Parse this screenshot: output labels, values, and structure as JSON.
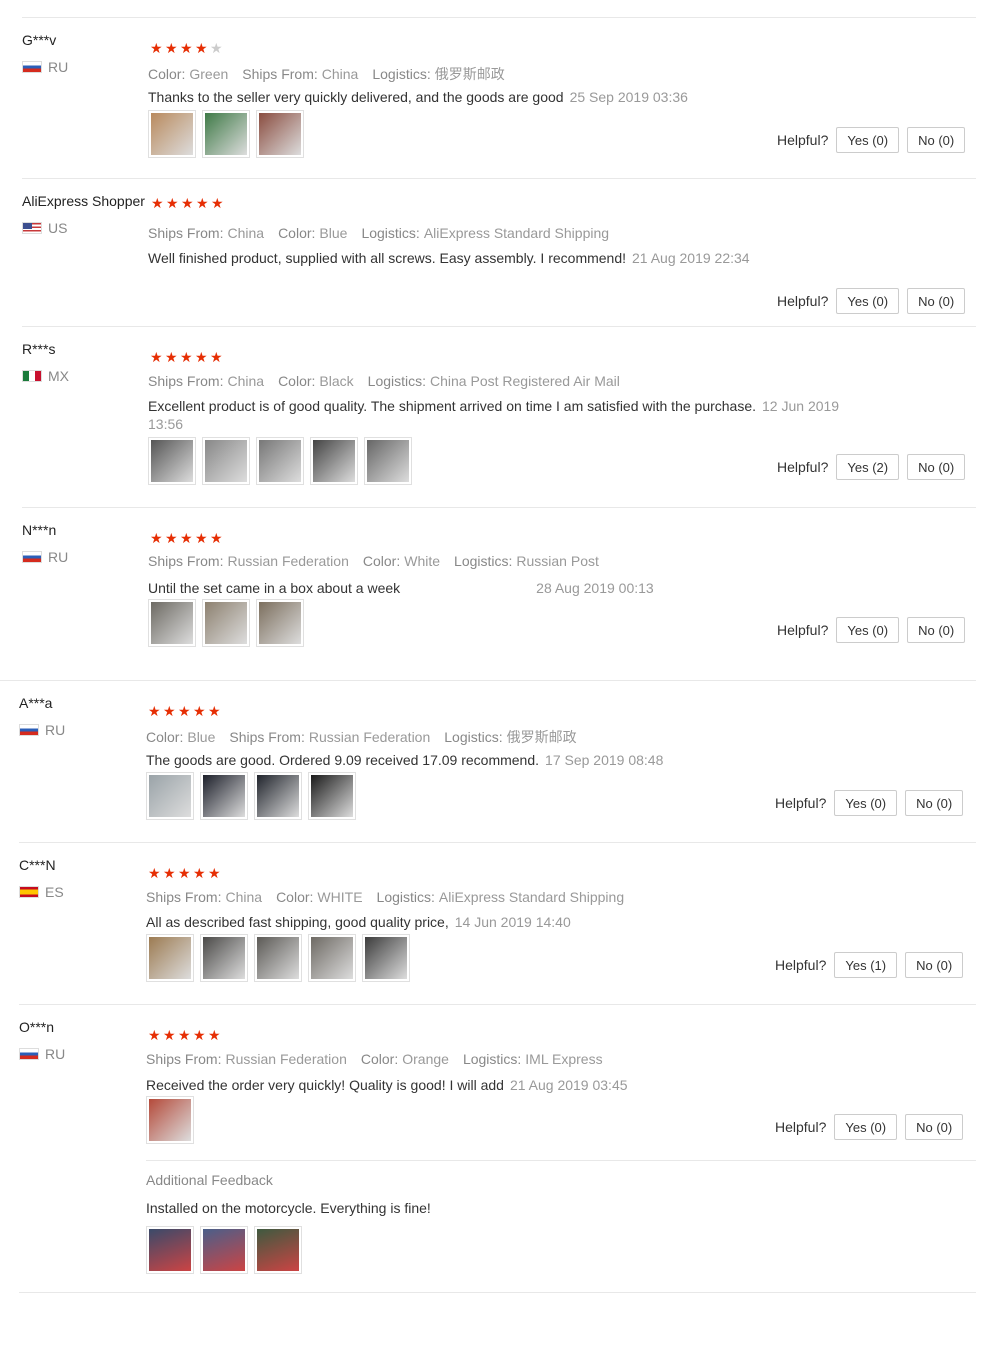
{
  "labels": {
    "helpful": "Helpful?",
    "ships_from": "Ships From:",
    "color": "Color:",
    "logistics": "Logistics:",
    "additional_feedback": "Additional Feedback"
  },
  "reviews": [
    {
      "user": "G***v",
      "country": "RU",
      "flag": "ru",
      "rating": 4,
      "meta": [
        [
          "color",
          "Green"
        ],
        [
          "ships_from",
          "China"
        ],
        [
          "logistics",
          "俄罗斯邮政"
        ]
      ],
      "text": "Thanks to the seller very quickly delivered, and the goods are good",
      "date": "25 Sep 2019 03:36",
      "photos": [
        "#b98a5e",
        "#3f7a47",
        "#8a4d40"
      ],
      "yes": "Yes (0)",
      "no": "No (0)"
    },
    {
      "user": "AliExpress Shopper",
      "country": "US",
      "flag": "us",
      "rating": 5,
      "meta": [
        [
          "ships_from",
          "China"
        ],
        [
          "color",
          "Blue"
        ],
        [
          "logistics",
          "AliExpress Standard Shipping"
        ]
      ],
      "text": "Well finished product, supplied with all screws. Easy assembly. I recommend!",
      "date": "21 Aug 2019 22:34",
      "photos": [],
      "yes": "Yes (0)",
      "no": "No (0)"
    },
    {
      "user": "R***s",
      "country": "MX",
      "flag": "mx",
      "rating": 5,
      "meta": [
        [
          "ships_from",
          "China"
        ],
        [
          "color",
          "Black"
        ],
        [
          "logistics",
          "China Post Registered Air Mail"
        ]
      ],
      "text": "Excellent product is of good quality. The shipment arrived on time I am satisfied with the purchase.",
      "date": "12 Jun 2019 13:56",
      "photos": [
        "#555",
        "#888",
        "#777",
        "#444",
        "#666"
      ],
      "yes": "Yes (2)",
      "no": "No (0)"
    },
    {
      "user": "N***n",
      "country": "RU",
      "flag": "ru",
      "rating": 5,
      "meta": [
        [
          "ships_from",
          "Russian Federation"
        ],
        [
          "color",
          "White"
        ],
        [
          "logistics",
          "Russian Post"
        ]
      ],
      "text": "Until the set came in a box about a week",
      "date": "28 Aug 2019 00:13",
      "photos": [
        "#6d6a63",
        "#8d8170",
        "#7c6f5e"
      ],
      "yes": "Yes (0)",
      "no": "No (0)"
    },
    {
      "user": "A***a",
      "country": "RU",
      "flag": "ru",
      "rating": 5,
      "meta": [
        [
          "color",
          "Blue"
        ],
        [
          "ships_from",
          "Russian Federation"
        ],
        [
          "logistics",
          "俄罗斯邮政"
        ]
      ],
      "text": "The goods are good. Ordered 9.09 received 17.09 recommend.",
      "date": "17 Sep 2019 08:48",
      "photos": [
        "#9aa3a8",
        "#1c1f2a",
        "#20242c",
        "#1a1a1a"
      ],
      "yes": "Yes (0)",
      "no": "No (0)"
    },
    {
      "user": "C***N",
      "country": "ES",
      "flag": "es",
      "rating": 5,
      "meta": [
        [
          "ships_from",
          "China"
        ],
        [
          "color",
          "WHITE"
        ],
        [
          "logistics",
          "AliExpress Standard Shipping"
        ]
      ],
      "text": "All as described fast shipping, good quality price,",
      "date": "14 Jun 2019 14:40",
      "photos": [
        "#9c7b52",
        "#4b4a48",
        "#5c5a56",
        "#6e6a64",
        "#3c3c3c"
      ],
      "yes": "Yes (1)",
      "no": "No (0)"
    },
    {
      "user": "O***n",
      "country": "RU",
      "flag": "ru",
      "rating": 5,
      "meta": [
        [
          "ships_from",
          "Russian Federation"
        ],
        [
          "color",
          "Orange"
        ],
        [
          "logistics",
          "IML Express"
        ]
      ],
      "text": "Received the order very quickly! Quality is good! I will add",
      "date": "21 Aug 2019 03:45",
      "photos": [
        "#b44a3a"
      ],
      "yes": "Yes (0)",
      "no": "No (0)",
      "additional": {
        "text": "Installed on the motorcycle. Everything is fine!",
        "photos": [
          "#3a4a6a",
          "#4a5f8a",
          "#3e5a3f"
        ]
      }
    }
  ]
}
